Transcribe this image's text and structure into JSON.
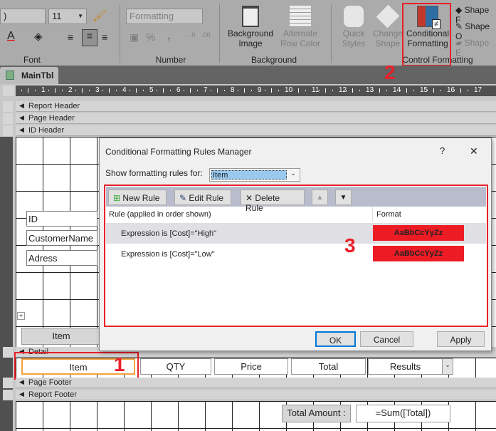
{
  "ribbon": {
    "font_name_value": ")",
    "font_size_value": "11",
    "number_format_value": "Formatting",
    "font_group": "Font",
    "number_group": "Number",
    "background_image": "Background",
    "background_image2": "Image",
    "alternate_row": "Alternate",
    "alternate_row2": "Row Color",
    "background_group": "Background",
    "quick_styles": "Quick",
    "quick_styles2": "Styles",
    "change_shape": "Change",
    "change_shape2": "Shape",
    "conditional": "Conditional",
    "conditional2": "Formatting",
    "control_group": "Control Formatting",
    "shape_fill": "Shape F",
    "shape_outline": "Shape O",
    "shape_effects": "Shape E",
    "percent": "%",
    "comma": ","
  },
  "document_tab": "MainTbl",
  "ruler": [
    "1",
    "2",
    "3",
    "4",
    "5",
    "6",
    "7",
    "8",
    "9",
    "10",
    "11",
    "12",
    "13",
    "14",
    "15",
    "16",
    "17"
  ],
  "bands": {
    "report_header": "Report Header",
    "page_header": "Page Header",
    "id_header": "ID Header",
    "detail": "Detail",
    "page_footer": "Page Footer",
    "report_footer": "Report Footer"
  },
  "id_header_controls": {
    "id": "ID",
    "customer": "CustomerName",
    "address": "Adress",
    "item_label": "Item"
  },
  "detail_controls": [
    "Item",
    "QTY",
    "Price",
    "Total",
    "Results"
  ],
  "footer": {
    "label": "Total Amount :",
    "expression": "=Sum([Total])"
  },
  "dialog": {
    "title": "Conditional Formatting Rules Manager",
    "help": "?",
    "close": "✕",
    "show_label": "Show formatting rules for:",
    "show_value": "Item",
    "new_rule": "New Rule",
    "edit_rule": "Edit Rule",
    "delete_rule": "Delete Rule",
    "col_rule": "Rule (applied in order shown)",
    "col_format": "Format",
    "rules": [
      {
        "rule": "Expression is [Cost]=\"High\"",
        "format": "AaBbCcYyZz"
      },
      {
        "rule": "Expression is [Cost]=\"Low\"",
        "format": "AaBbCcYyZz"
      }
    ],
    "ok": "OK",
    "cancel": "Cancel",
    "apply": "Apply"
  },
  "annotations": [
    "1",
    "2",
    "3"
  ],
  "colors": {
    "annotation": "#e8202a",
    "format_preview": "#ed1c24",
    "selected_control": "#f4a340"
  }
}
